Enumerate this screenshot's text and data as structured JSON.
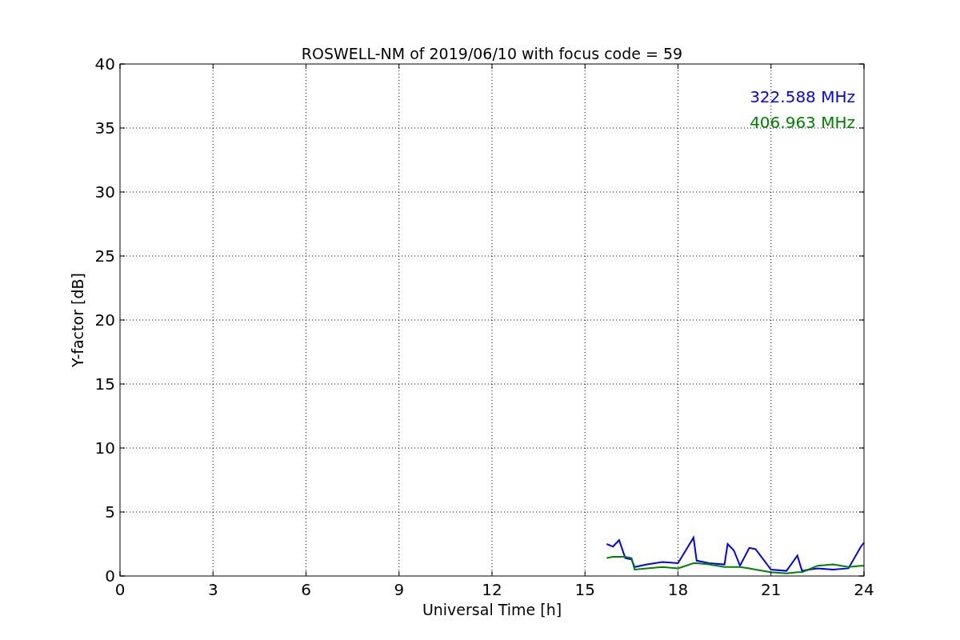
{
  "chart_data": {
    "type": "line",
    "title": "ROSWELL-NM of 2019/06/10 with focus code = 59",
    "xlabel": "Universal Time [h]",
    "ylabel": "Y-factor [dB]",
    "xlim": [
      0,
      24
    ],
    "ylim": [
      0,
      40
    ],
    "xticks": [
      0,
      3,
      6,
      9,
      12,
      15,
      18,
      21,
      24
    ],
    "yticks": [
      0,
      5,
      10,
      15,
      20,
      25,
      30,
      35,
      40
    ],
    "grid": true,
    "x": [
      15.7,
      15.9,
      16.1,
      16.3,
      16.5,
      16.6,
      17,
      17.5,
      18,
      18.5,
      18.6,
      19,
      19.5,
      19.6,
      19.8,
      20,
      20.3,
      20.5,
      21,
      21.5,
      21.85,
      22,
      22.5,
      23,
      23.5,
      23.9,
      24
    ],
    "series": [
      {
        "name": "322.588 MHz",
        "color": "#0000ff",
        "values": [
          2.5,
          2.3,
          2.8,
          1.4,
          1.3,
          0.7,
          0.9,
          1.1,
          1.0,
          3.0,
          1.2,
          1.0,
          0.9,
          2.5,
          2.0,
          0.8,
          2.2,
          2.1,
          0.5,
          0.4,
          1.6,
          0.4,
          0.6,
          0.5,
          0.6,
          2.3,
          2.6
        ]
      },
      {
        "name": "406.963 MHz",
        "color": "#008000",
        "values": [
          1.4,
          1.5,
          1.5,
          1.5,
          1.4,
          0.5,
          0.6,
          0.7,
          0.6,
          1.0,
          1.0,
          0.9,
          0.7,
          0.7,
          0.7,
          0.7,
          0.6,
          0.5,
          0.3,
          0.2,
          0.3,
          0.3,
          0.8,
          0.9,
          0.7,
          0.8,
          0.8
        ]
      }
    ]
  }
}
